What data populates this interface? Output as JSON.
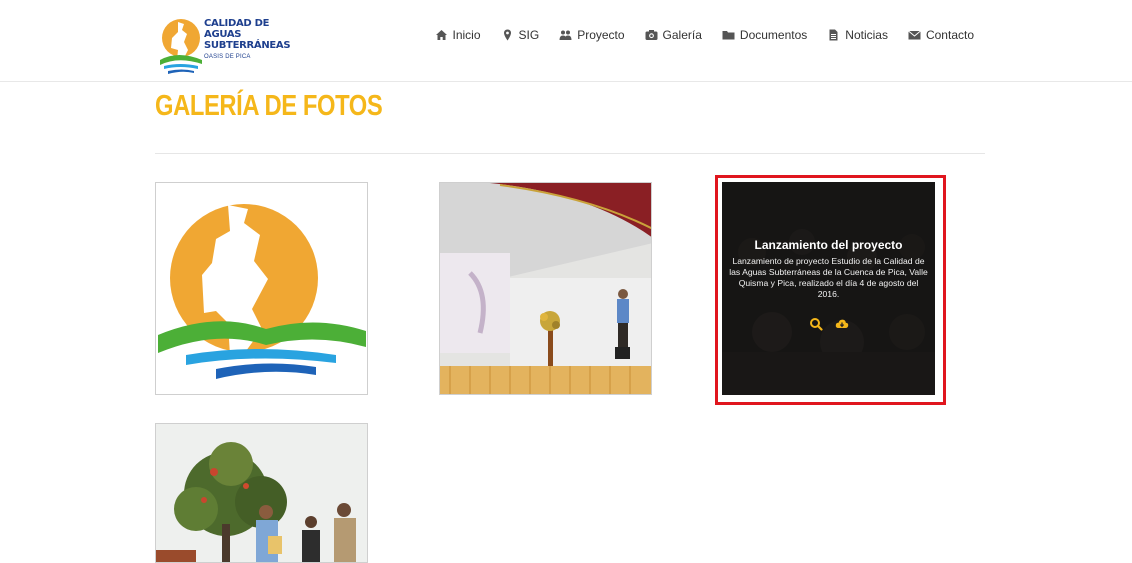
{
  "brand": {
    "line1": "CALIDAD DE AGUAS",
    "line2": "SUBTERRÁNEAS",
    "line3": "OASIS DE PICA"
  },
  "nav": [
    {
      "label": "Inicio",
      "icon": "home-icon"
    },
    {
      "label": "SIG",
      "icon": "map-marker-icon"
    },
    {
      "label": "Proyecto",
      "icon": "users-icon"
    },
    {
      "label": "Galería",
      "icon": "camera-icon"
    },
    {
      "label": "Documentos",
      "icon": "folder-icon"
    },
    {
      "label": "Noticias",
      "icon": "file-icon"
    },
    {
      "label": "Contacto",
      "icon": "envelope-icon"
    }
  ],
  "page_title": "GALERÍA DE FOTOS",
  "gallery": {
    "items": [
      {
        "kind": "logo"
      },
      {
        "kind": "photo",
        "subject": "stage-presentation"
      },
      {
        "kind": "photo",
        "subject": "audience",
        "caption_title": "Lanzamiento del proyecto",
        "caption_text": "Lanzamiento de proyecto Estudio de la Calidad de las Aguas Subterráneas de la Cuenca de Pica, Valle Quisma y Pica, realizado el día 4 de agosto del 2016.",
        "actions": [
          "search-icon",
          "cloud-download-icon"
        ]
      },
      {
        "kind": "photo",
        "subject": "outdoor-tree"
      }
    ]
  },
  "colors": {
    "accent": "#f5b71a",
    "highlight": "#e0161e",
    "brand_blue": "#1e3f8e",
    "brand_green": "#4caf37"
  }
}
